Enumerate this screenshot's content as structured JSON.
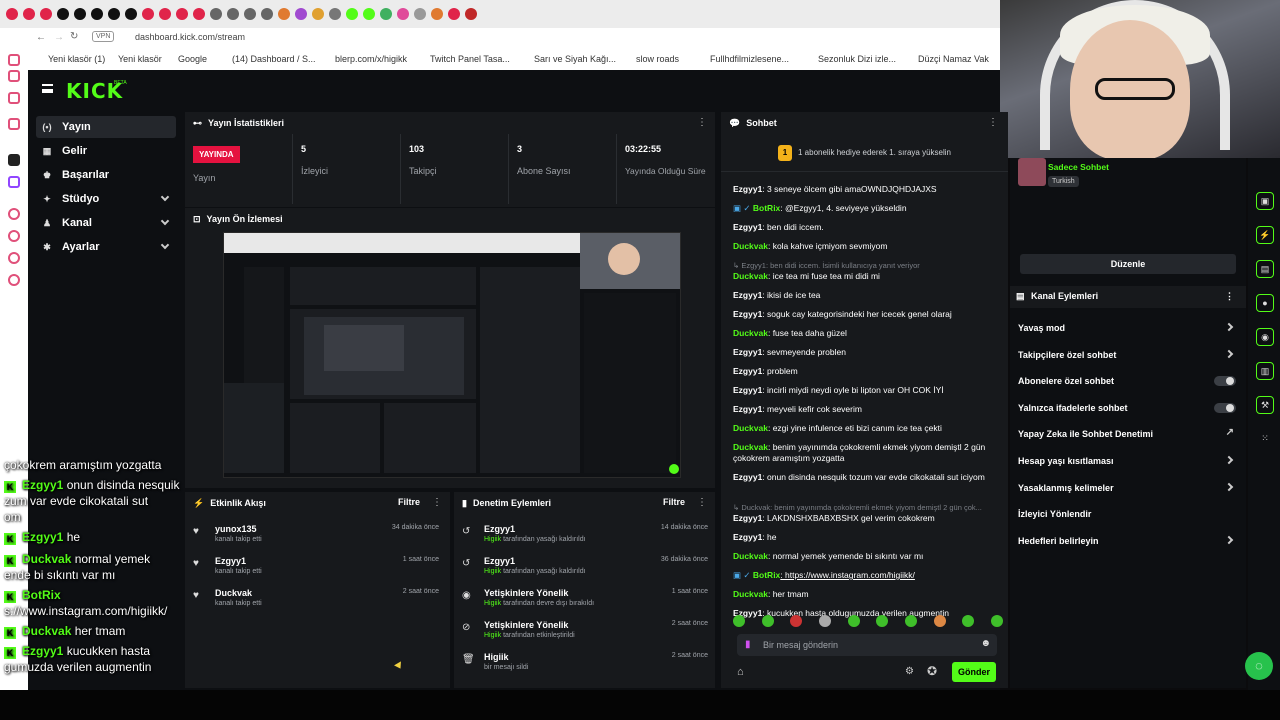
{
  "browser": {
    "url": "dashboard.kick.com/stream",
    "vpn_label": "VPN",
    "bookmarks": [
      "Yeni klasör (1)",
      "Yeni klasör",
      "Google",
      "(14) Dashboard / S...",
      "blerp.com/x/higikk",
      "Twitch Panel Tasa...",
      "Sarı ve Siyah Kağı...",
      "slow roads",
      "Fullhdfilmizlesene...",
      "Sezonluk Dizi izle...",
      "Düzçi Namaz Vak"
    ]
  },
  "app": {
    "logo": "KICK",
    "beta": "BETA"
  },
  "sidebar": {
    "items": [
      {
        "label": "Yayın",
        "icon": "(•)"
      },
      {
        "label": "Gelir",
        "icon": "▦"
      },
      {
        "label": "Başarılar",
        "icon": "♚"
      },
      {
        "label": "Stüdyo",
        "icon": "✦"
      },
      {
        "label": "Kanal",
        "icon": "♟"
      },
      {
        "label": "Ayarlar",
        "icon": "✱"
      }
    ]
  },
  "stats": {
    "title": "Yayın İstatistikleri",
    "live_badge": "YAYINDA",
    "live_label": "Yayın",
    "items": [
      {
        "value": "5",
        "label": "İzleyici"
      },
      {
        "value": "103",
        "label": "Takipçi"
      },
      {
        "value": "3",
        "label": "Abone Sayısı"
      },
      {
        "value": "03:22:55",
        "label": "Yayında Olduğu Süre"
      }
    ]
  },
  "preview": {
    "title": "Yayın Ön İzlemesi"
  },
  "activity": {
    "title": "Etkinlik Akışı",
    "filter": "Filtre",
    "items": [
      {
        "name": "yunox135",
        "sub": "kanalı takip etti",
        "time": "34 dakika önce"
      },
      {
        "name": "Ezgyy1",
        "sub": "kanalı takip etti",
        "time": "1 saat önce"
      },
      {
        "name": "Duckvak",
        "sub": "kanalı takip etti",
        "time": "2 saat önce"
      }
    ]
  },
  "moderation": {
    "title": "Denetim Eylemleri",
    "filter": "Filtre",
    "items": [
      {
        "icon": "↺",
        "name": "Ezgyy1",
        "by": "Higiik",
        "sub": " tarafından yasağı kaldırıldı",
        "time": "14 dakika önce"
      },
      {
        "icon": "↺",
        "name": "Ezgyy1",
        "by": "Higiik",
        "sub": " tarafından yasağı kaldırıldı",
        "time": "36 dakika önce"
      },
      {
        "icon": "◉",
        "name": "Yetişkinlere Yönelik",
        "by": "Higiik",
        "sub": " tarafından devre dışı bırakıldı",
        "time": "1 saat önce"
      },
      {
        "icon": "⊘",
        "name": "Yetişkinlere Yönelik",
        "by": "Higiik",
        "sub": " tarafından etkinleştirildi",
        "time": "2 saat önce"
      },
      {
        "icon": "🗑",
        "name": "Higiik",
        "by": "",
        "sub": "bir mesajı sildi",
        "time": "2 saat önce"
      }
    ]
  },
  "chat": {
    "title": "Sohbet",
    "gift_text": "1 abonelik hediye ederek 1. sıraya yükselin",
    "messages": [
      {
        "user": "Ezgyy1",
        "color": "#ffffff",
        "text": ": 3 seneye ölcem gibi amaOWNDJQHDJAJXS"
      },
      {
        "user": "BotRix",
        "color": "#53fc18",
        "text": ": @Ezgyy1, 4. seviyeye yükseldin",
        "bot": true
      },
      {
        "user": "Ezgyy1",
        "color": "#ffffff",
        "text": ": ben didi iccem."
      },
      {
        "user": "Duckvak",
        "color": "#53fc18",
        "text": ": kola kahve içmiyom sevmiyom"
      },
      {
        "reply": "↳ Ezgyy1: ben didi iccem. İsimli kullanıcıya yanıt veriyor",
        "user": "Duckvak",
        "color": "#53fc18",
        "text": ": ice tea mi fuse tea mi didi mi"
      },
      {
        "user": "Ezgyy1",
        "color": "#ffffff",
        "text": ": ikisi de ice tea"
      },
      {
        "user": "Ezgyy1",
        "color": "#ffffff",
        "text": ": soguk cay kategorisindeki her icecek genel olaraj"
      },
      {
        "user": "Duckvak",
        "color": "#53fc18",
        "text": ": fuse tea daha güzel"
      },
      {
        "user": "Ezgyy1",
        "color": "#ffffff",
        "text": ": sevmeyende problen"
      },
      {
        "user": "Ezgyy1",
        "color": "#ffffff",
        "text": ": problem"
      },
      {
        "user": "Ezgyy1",
        "color": "#ffffff",
        "text": ": incirli miydi neydi oyle bi lipton var OH COK İYİ"
      },
      {
        "user": "Ezgyy1",
        "color": "#ffffff",
        "text": ": meyveli kefir cok severim"
      },
      {
        "user": "Duckvak",
        "color": "#53fc18",
        "text": ": ezgi yine infulence eti bizi canım ice tea çekti"
      },
      {
        "user": "Duckvak",
        "color": "#53fc18",
        "text": ": benim yayınımda çokokremli ekmek yiyom demiştl 2 gün çokokrem aramıştım yozgatta"
      },
      {
        "user": "Ezgyy1",
        "color": "#ffffff",
        "text": ": onun disinda nesquik tozum var evde cikokatali sut iciyom"
      },
      {
        "reply": "↳ Duckvak: benim yayınımda çokokremli ekmek yiyom demiştl 2 gün çok...",
        "user": "Ezgyy1",
        "color": "#ffffff",
        "text": ": LAKDNSHXBABXBSHX gel verim cokokrem"
      },
      {
        "user": "Ezgyy1",
        "color": "#ffffff",
        "text": ": he"
      },
      {
        "user": "Duckvak",
        "color": "#53fc18",
        "text": ": normal yemek yemende bi sıkıntı var mı"
      },
      {
        "user": "BotRix",
        "color": "#53fc18",
        "text": ": https://www.instagram.com/higiikk/",
        "bot": true
      },
      {
        "user": "Duckvak",
        "color": "#53fc18",
        "text": ": her tmam"
      },
      {
        "user": "Ezgyy1",
        "color": "#ffffff",
        "text": ": kucukken hasta oldugumuzda verilen augmentin"
      }
    ],
    "input_placeholder": "Bir mesaj gönderin",
    "send_label": "Gönder"
  },
  "right": {
    "chat_mode_title": "Sadece Sohbet",
    "chat_mode_lang": "Turkish",
    "edit_label": "Düzenle",
    "actions_title": "Kanal Eylemleri",
    "actions": [
      {
        "label": "Yavaş mod",
        "type": "chevron"
      },
      {
        "label": "Takipçilere özel sohbet",
        "type": "chevron"
      },
      {
        "label": "Abonelere özel sohbet",
        "type": "toggle"
      },
      {
        "label": "Yalnızca ifadelerle sohbet",
        "type": "toggle"
      },
      {
        "label": "Yapay Zeka ile Sohbet Denetimi",
        "type": "external"
      },
      {
        "label": "Hesap yaşı kısıtlaması",
        "type": "chevron"
      },
      {
        "label": "Yasaklanmış kelimeler",
        "type": "chevron"
      },
      {
        "label": "İzleyici Yönlendir",
        "type": "none"
      },
      {
        "label": "Hedefleri belirleyin",
        "type": "chevron"
      }
    ]
  },
  "overlay": {
    "lines": [
      {
        "badge": false,
        "user": "",
        "text": "çokokrem aramıştım yozgatta"
      },
      {
        "badge": true,
        "user": "Ezgyy1",
        "text": " onun disinda nesquik"
      },
      {
        "badge": false,
        "user": "",
        "text": "zum var evde cikokatali sut"
      },
      {
        "badge": false,
        "user": "",
        "text": "om"
      },
      {
        "badge": true,
        "user": "Ezgyy1",
        "text": " he"
      },
      {
        "badge": true,
        "user": "Duckvak",
        "text": " normal yemek"
      },
      {
        "badge": false,
        "user": "",
        "text": "ende bi sıkıntı var mı"
      },
      {
        "badge": true,
        "user": "BotRix",
        "text": ""
      },
      {
        "badge": false,
        "user": "",
        "text": "s://www.instagram.com/higiikk/"
      },
      {
        "badge": true,
        "user": "Duckvak",
        "text": " her tmam"
      },
      {
        "badge": true,
        "user": "Ezgyy1",
        "text": " kucukken hasta"
      },
      {
        "badge": false,
        "user": "",
        "text": "gumuzda verilen augmentin"
      }
    ]
  },
  "colors": {
    "accent": "#53fc18",
    "live": "#e5123f",
    "panel": "#17191c",
    "bg": "#0d0f12"
  }
}
